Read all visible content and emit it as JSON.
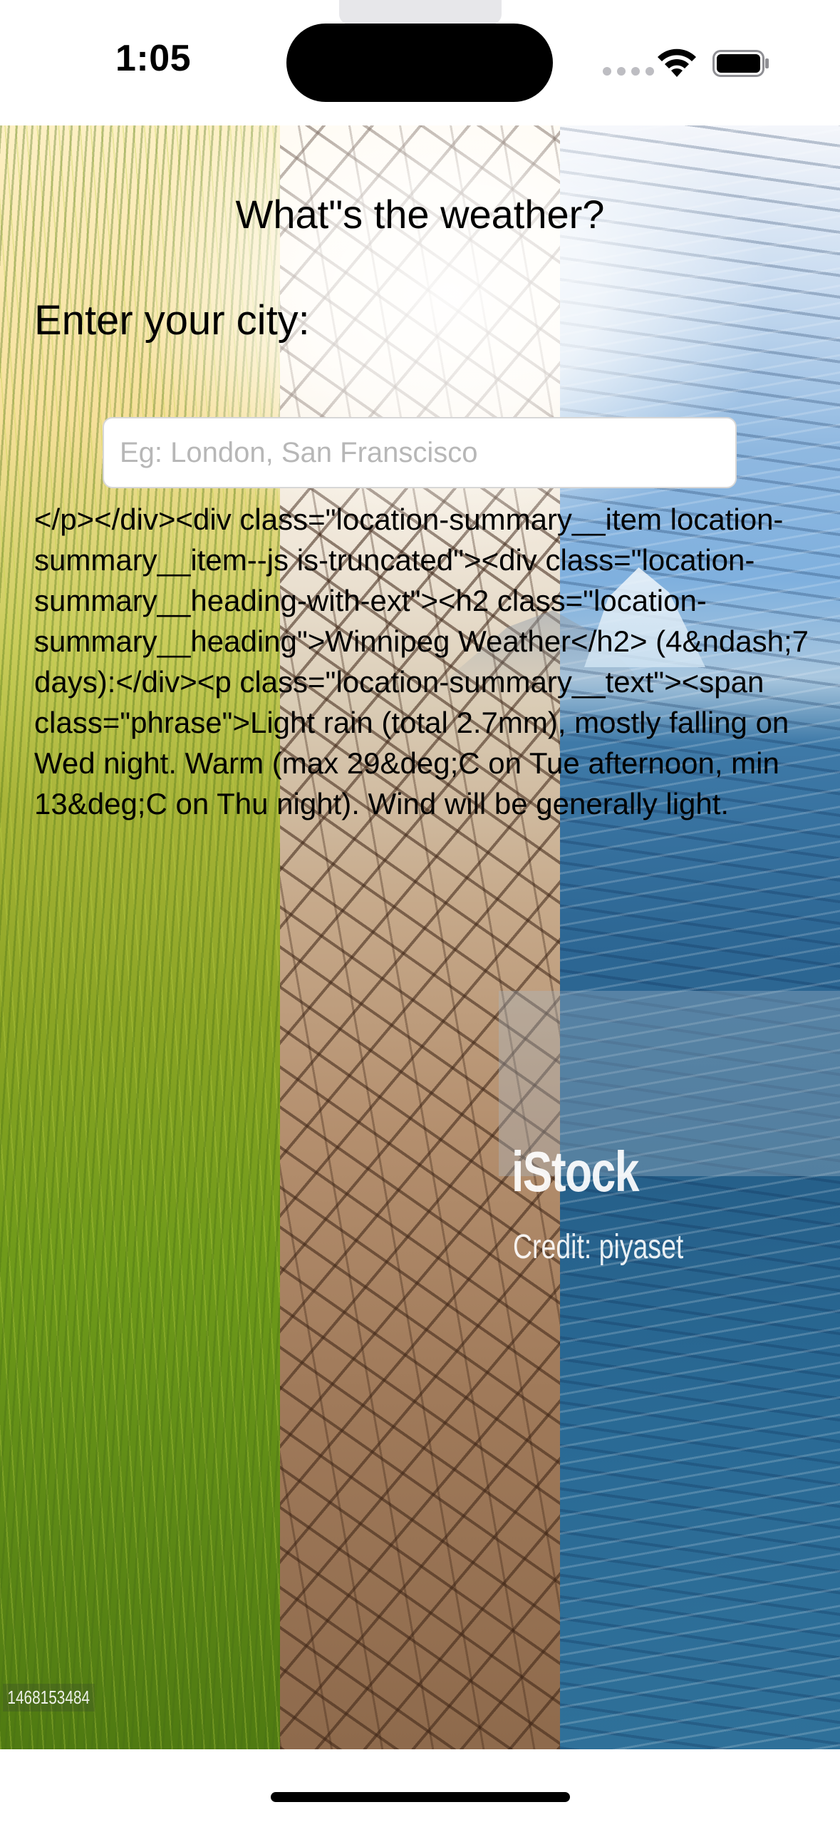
{
  "status_bar": {
    "time": "1:05",
    "wifi_icon": "wifi-icon",
    "battery_icon": "battery-full-icon"
  },
  "app": {
    "title": "What\"s the weather?",
    "city_label": "Enter your city:",
    "city_input": {
      "value": "",
      "placeholder": "Eg: London, San Franscisco"
    },
    "result_text": "</p></div><div class=\"location-summary__item location-summary__item--js is-truncated\"><div class=\"location-summary__heading-with-ext\"><h2 class=\"location-summary__heading\">Winnipeg Weather</h2> (4&ndash;7 days):</div><p class=\"location-summary__text\"><span class=\"phrase\">Light rain (total 2.7mm), mostly falling on Wed night. Warm (max 29&deg;C on Tue afternoon, min 13&deg;C on Thu night). Wind will be generally light."
  },
  "background": {
    "watermark_brand": "iStock",
    "watermark_credit": "Credit: piyaset",
    "image_id": "1468153484"
  },
  "colors": {
    "rice_green": "#6f9a1a",
    "soil_brown": "#a07a5a",
    "sea_blue": "#2d6794",
    "input_border": "#d7d7d7"
  }
}
